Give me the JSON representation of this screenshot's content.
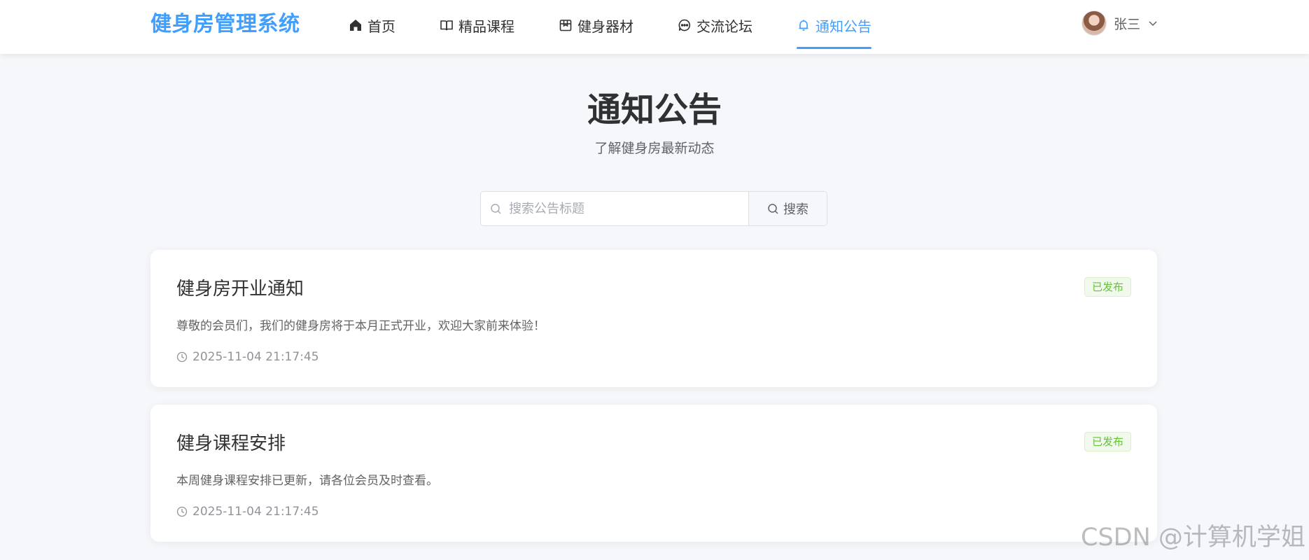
{
  "header": {
    "logo": "健身房管理系统",
    "nav": [
      {
        "label": "首页",
        "icon": "home-icon",
        "active": false
      },
      {
        "label": "精品课程",
        "icon": "book-icon",
        "active": false
      },
      {
        "label": "健身器材",
        "icon": "box-icon",
        "active": false
      },
      {
        "label": "交流论坛",
        "icon": "chat-icon",
        "active": false
      },
      {
        "label": "通知公告",
        "icon": "bell-icon",
        "active": true
      }
    ],
    "user": {
      "name": "张三"
    }
  },
  "page": {
    "title": "通知公告",
    "subtitle": "了解健身房最新动态"
  },
  "search": {
    "placeholder": "搜索公告标题",
    "button_label": "搜索"
  },
  "notices": [
    {
      "title": "健身房开业通知",
      "status": "已发布",
      "content": "尊敬的会员们，我们的健身房将于本月正式开业，欢迎大家前来体验！",
      "time": "2025-11-04 21:17:45"
    },
    {
      "title": "健身课程安排",
      "status": "已发布",
      "content": "本周健身课程安排已更新，请各位会员及时查看。",
      "time": "2025-11-04 21:17:45"
    }
  ],
  "colors": {
    "accent": "#409eff",
    "status_success": "#67c23a",
    "background": "#f5f7fa"
  },
  "watermark": "CSDN @计算机学姐"
}
